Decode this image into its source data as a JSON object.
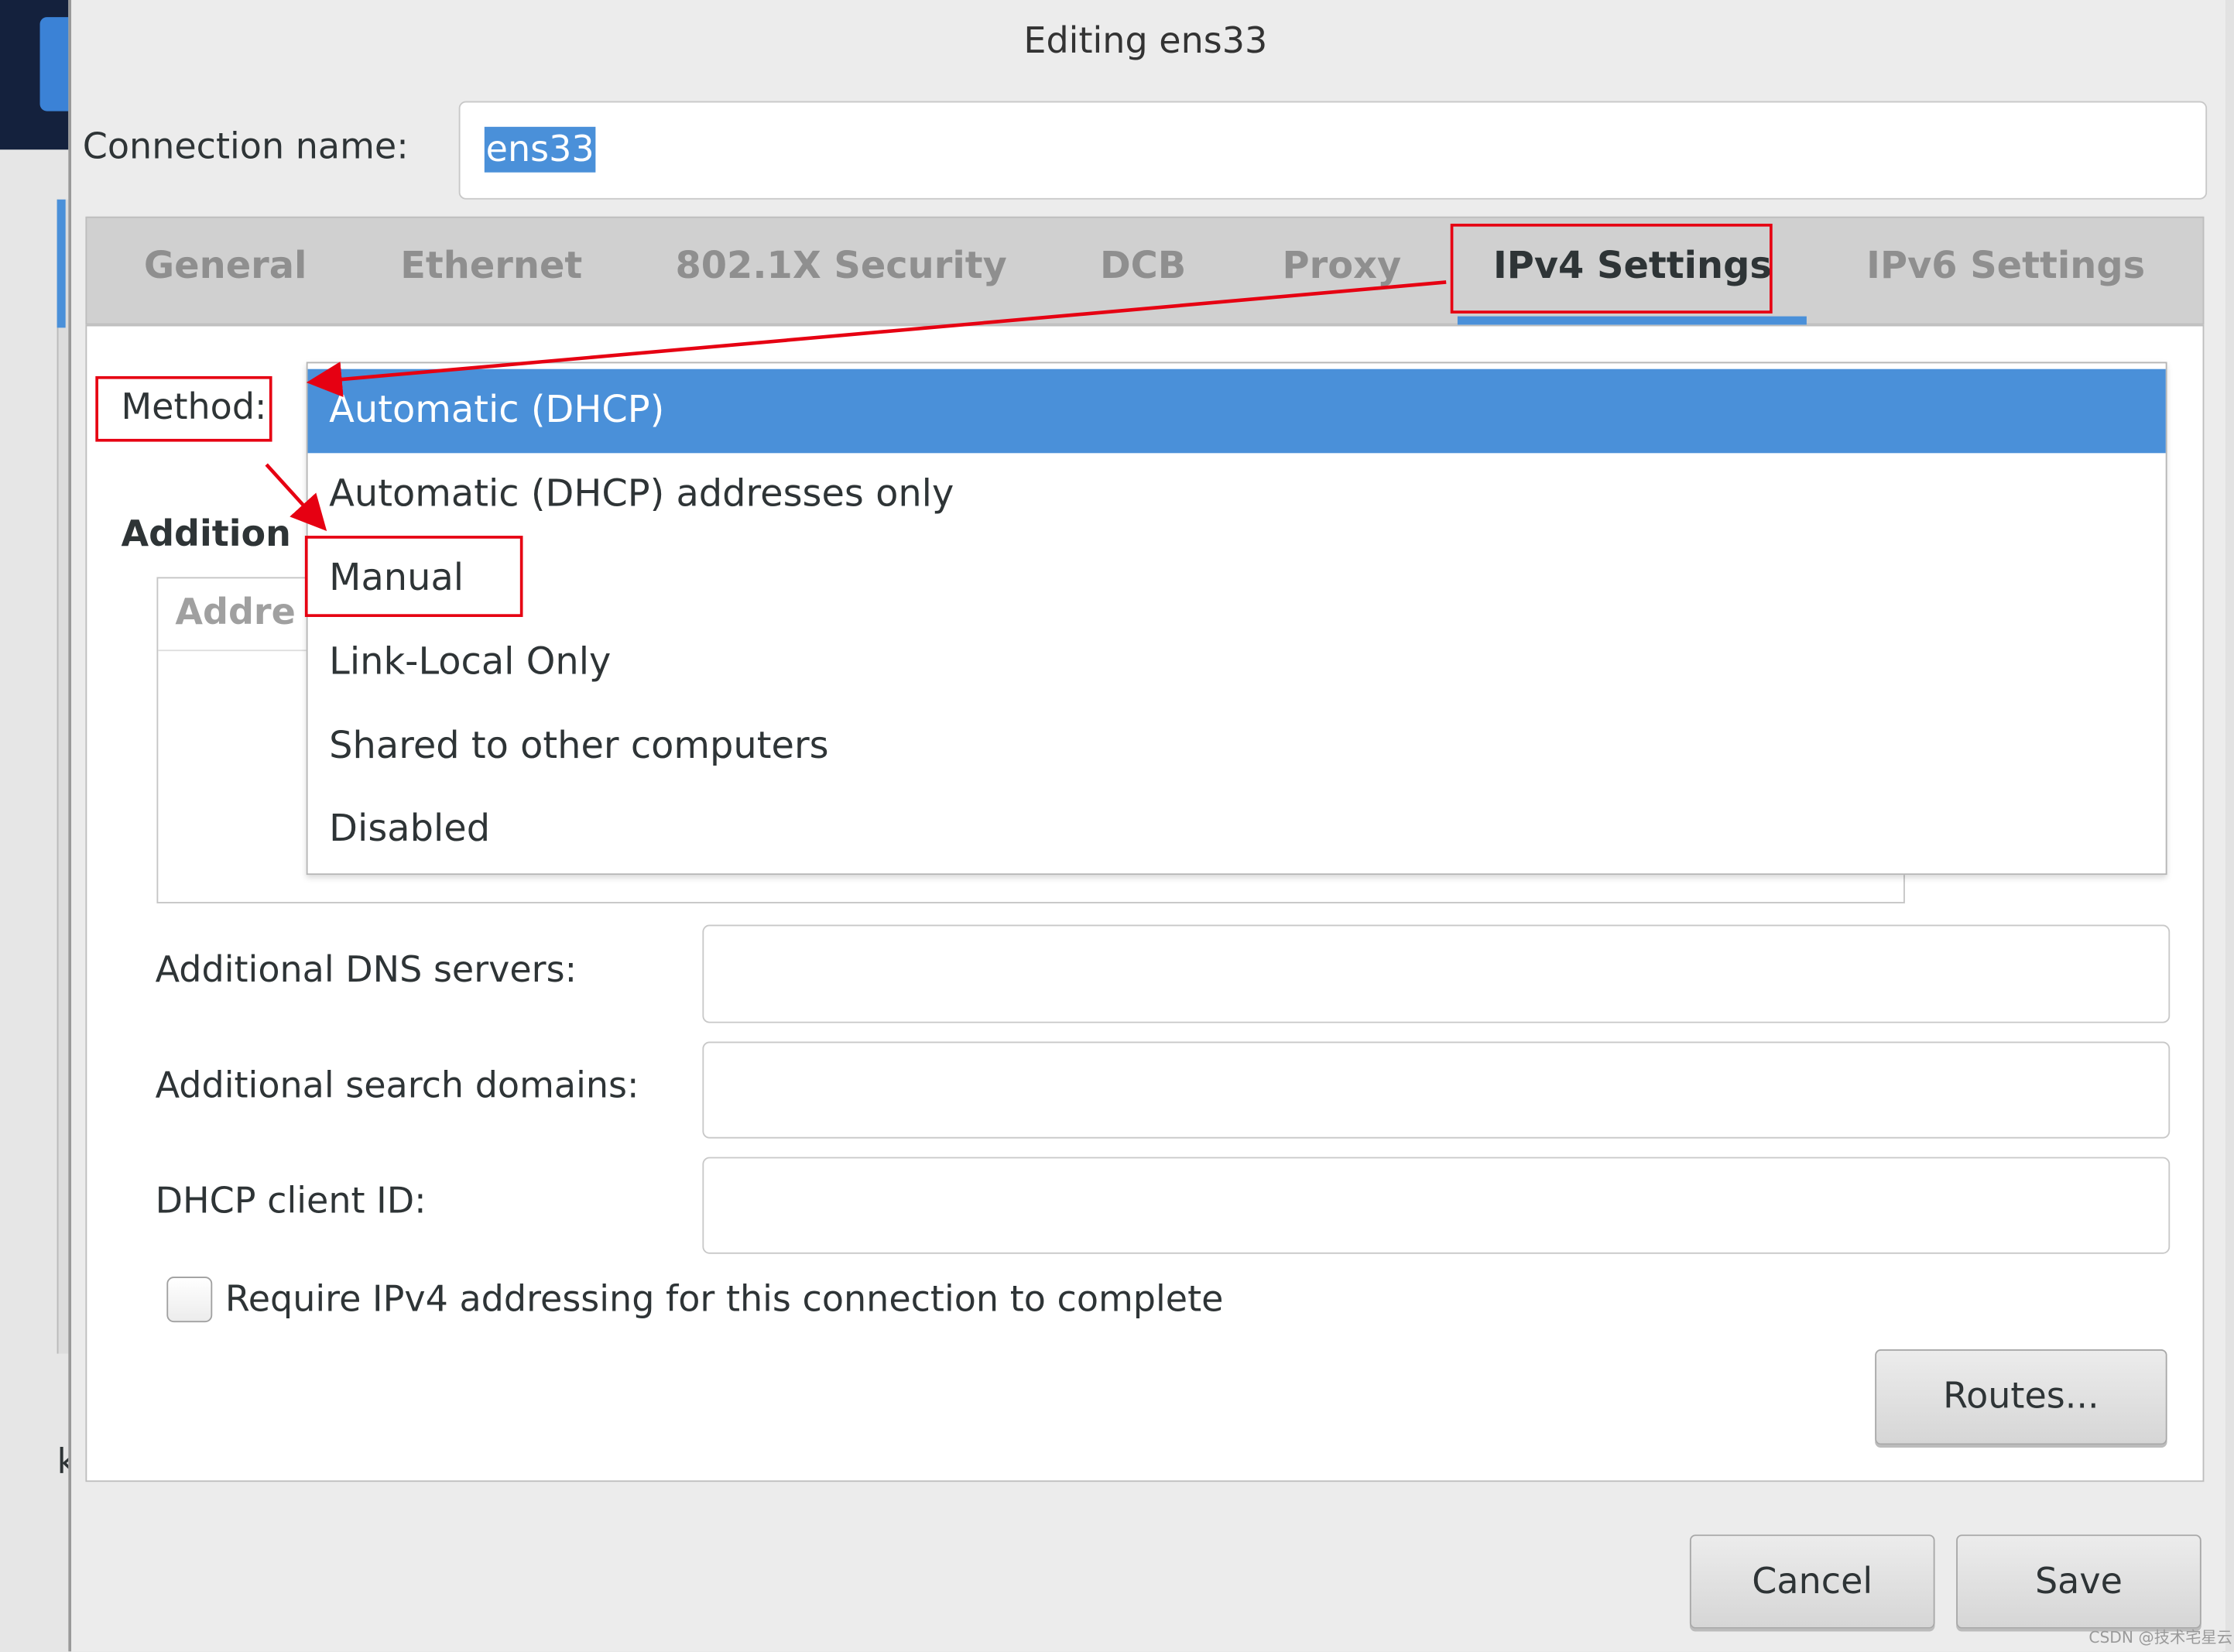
{
  "window": {
    "title": "Editing ens33"
  },
  "connection": {
    "label": "Connection name:",
    "value": "ens33"
  },
  "tabs": [
    {
      "label": "General",
      "active": false
    },
    {
      "label": "Ethernet",
      "active": false
    },
    {
      "label": "802.1X Security",
      "active": false
    },
    {
      "label": "DCB",
      "active": false
    },
    {
      "label": "Proxy",
      "active": false
    },
    {
      "label": "IPv4 Settings",
      "active": true
    },
    {
      "label": "IPv6 Settings",
      "active": false
    }
  ],
  "ipv4": {
    "method_label": "Method:",
    "additional_heading": "Addition",
    "addresses_header": "Addre",
    "method_options": [
      {
        "label": "Automatic (DHCP)",
        "selected": true
      },
      {
        "label": "Automatic (DHCP) addresses only",
        "selected": false
      },
      {
        "label": "Manual",
        "selected": false
      },
      {
        "label": "Link-Local Only",
        "selected": false
      },
      {
        "label": "Shared to other computers",
        "selected": false
      },
      {
        "label": "Disabled",
        "selected": false
      }
    ],
    "dns_label": "Additional DNS servers:",
    "dns_value": "",
    "search_label": "Additional search domains:",
    "search_value": "",
    "dhcp_label": "DHCP client ID:",
    "dhcp_value": "",
    "require_label": "Require IPv4 addressing for this connection to complete",
    "require_checked": false,
    "routes_button": "Routes..."
  },
  "footer": {
    "cancel": "Cancel",
    "save": "Save"
  },
  "watermark": "CSDN @技术宅星云",
  "background_fragment": "k",
  "colors": {
    "accent": "#4a90d9",
    "annotation": "#e60012",
    "dialog_bg": "#ececec",
    "desktop": "#14213d"
  }
}
